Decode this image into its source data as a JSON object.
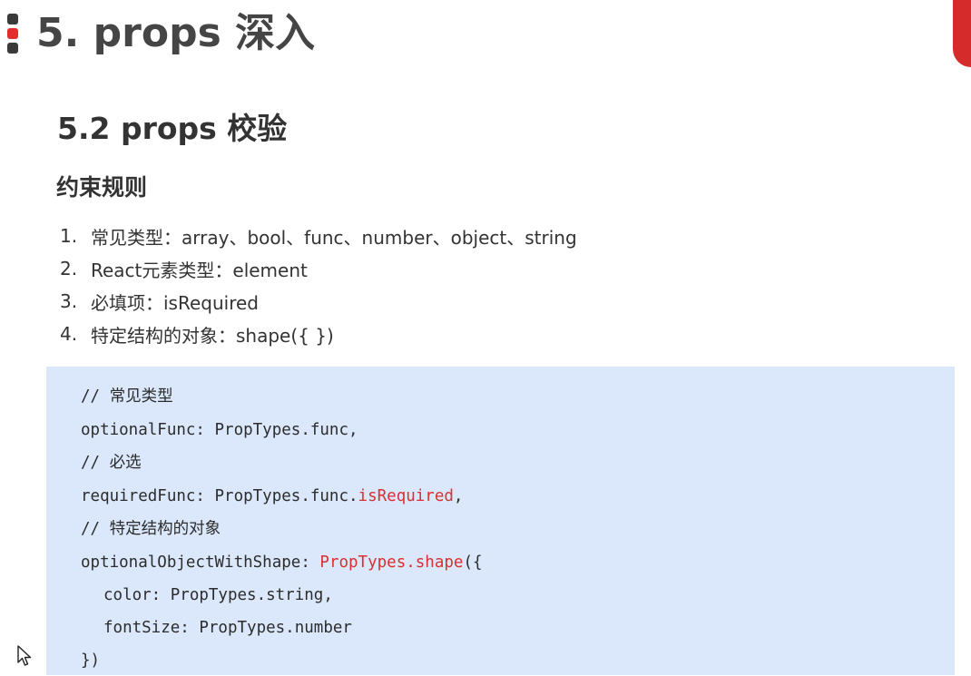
{
  "header": {
    "title": "5. props 深入",
    "accent_color": "#d62b2b"
  },
  "section": {
    "title": "5.2 props 校验",
    "subtitle": "约束规则"
  },
  "rules": [
    {
      "num": "1.",
      "text": "常见类型：array、bool、func、number、object、string"
    },
    {
      "num": "2.",
      "text": "React元素类型：element"
    },
    {
      "num": "3.",
      "text": "必填项：isRequired"
    },
    {
      "num": "4.",
      "text": "特定结构的对象：shape({  })"
    }
  ],
  "code": {
    "background_color": "#dbe8fb",
    "highlight_color": "#d93030",
    "lines": {
      "comment_common": "// 常见类型",
      "optional_func": "optionalFunc: PropTypes.func,",
      "comment_required": "// 必选",
      "required_func_prefix": "requiredFunc: PropTypes.func.",
      "required_func_keyword": "isRequired",
      "required_func_suffix": ",",
      "comment_shape": "// 特定结构的对象",
      "shape_prefix": "optionalObjectWithShape: ",
      "shape_keyword": "PropTypes.shape",
      "shape_suffix": "({",
      "color_prop": "color: PropTypes.string,",
      "font_size_prop": "fontSize: PropTypes.number",
      "closing": "})"
    }
  },
  "icons": {
    "cursor": "mouse-pointer-icon"
  }
}
